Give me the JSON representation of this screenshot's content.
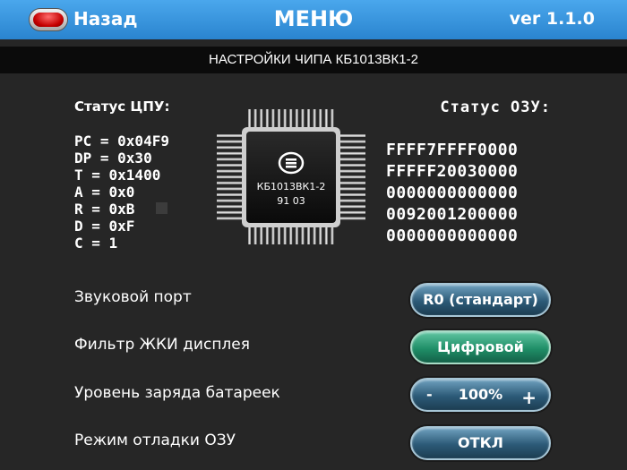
{
  "header": {
    "back_label": "Назад",
    "title": "МЕНЮ",
    "version": "ver 1.1.0"
  },
  "subheader": {
    "title": "НАСТРОЙКИ ЧИПА КБ1013ВК1-2"
  },
  "cpu": {
    "title": "Статус ЦПУ:",
    "registers": [
      "PC = 0x04F9",
      "DP = 0x30",
      "T = 0x1400",
      "A = 0x0",
      "R = 0xB",
      "D = 0xF",
      "C = 1"
    ]
  },
  "chip": {
    "name": "КБ1013ВК1-2",
    "code": "91 03"
  },
  "ram": {
    "title": "Статус ОЗУ:",
    "rows": [
      "FFFF7FFFF0000",
      "FFFFF20030000",
      "0000000000000",
      "0092001200000",
      "0000000000000"
    ]
  },
  "settings": [
    {
      "label": "Звуковой порт",
      "value": "R0 (стандарт)",
      "style": "blue"
    },
    {
      "label": "Фильтр ЖКИ дисплея",
      "value": "Цифровой",
      "style": "green"
    },
    {
      "label": "Уровень заряда батареек",
      "value": "100%",
      "minus": "-",
      "plus": "+",
      "style": "blue"
    },
    {
      "label": "Режим отладки ОЗУ",
      "value": "ОТКЛ",
      "style": "blue"
    }
  ],
  "colors": {
    "header_blue": "#3d9be2",
    "button_blue": "#2c5a77",
    "button_green": "#1f8e67",
    "background": "#262626"
  }
}
